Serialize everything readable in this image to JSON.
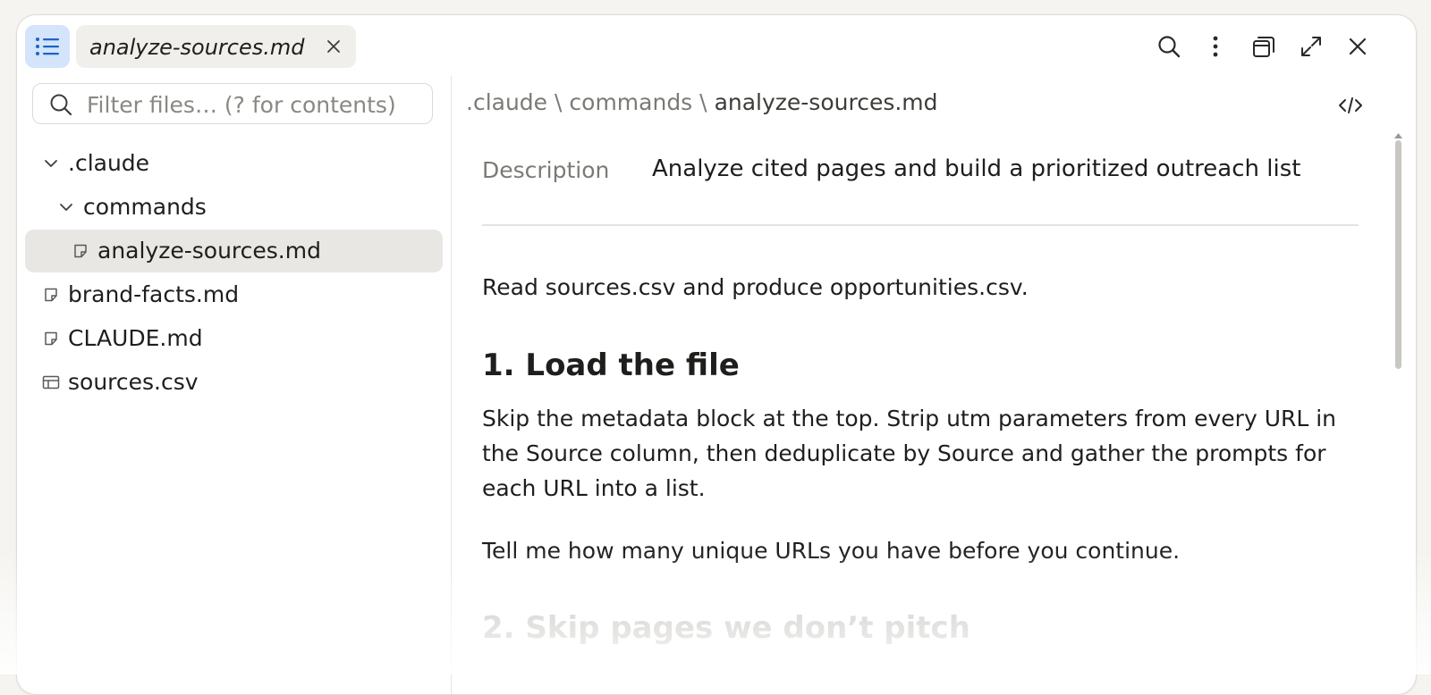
{
  "tab": {
    "title": "analyze-sources.md"
  },
  "sidebar": {
    "filter_placeholder": "Filter files… (? for contents)",
    "tree": [
      {
        "label": ".claude",
        "type": "folder",
        "expanded": true,
        "depth": 0
      },
      {
        "label": "commands",
        "type": "folder",
        "expanded": true,
        "depth": 1
      },
      {
        "label": "analyze-sources.md",
        "type": "file",
        "depth": 2,
        "selected": true
      },
      {
        "label": "brand-facts.md",
        "type": "file",
        "depth": 0
      },
      {
        "label": "CLAUDE.md",
        "type": "file",
        "depth": 0
      },
      {
        "label": "sources.csv",
        "type": "table",
        "depth": 0
      }
    ]
  },
  "breadcrumb": {
    "part1": ".claude",
    "sep": "\\",
    "part2": "commands",
    "current": "analyze-sources.md"
  },
  "document": {
    "description_key": "Description",
    "description_value": "Analyze cited pages and build a prioritized outreach list",
    "intro": "Read sources.csv and produce opportunities.csv.",
    "section1_heading": "1. Load the file",
    "section1_body": "Skip the metadata block at the top. Strip utm parameters from every URL in the Source column, then deduplicate by Source and gather the prompts for each URL into a list.",
    "section1_note": "Tell me how many unique URLs you have before you continue.",
    "section2_heading": "2. Skip pages we don’t pitch"
  },
  "colors": {
    "accent_toggle": "#d3e4fb",
    "selected_row": "#e8e7e3",
    "text": "#1f1e1d",
    "muted": "#7c7a75"
  },
  "icons": {
    "toggle": "list-icon",
    "tab_close": "close-icon",
    "search": "search-icon",
    "menu": "more-vertical-icon",
    "windows": "window-stack-icon",
    "expand": "expand-icon",
    "close": "close-icon",
    "code": "code-icon"
  }
}
